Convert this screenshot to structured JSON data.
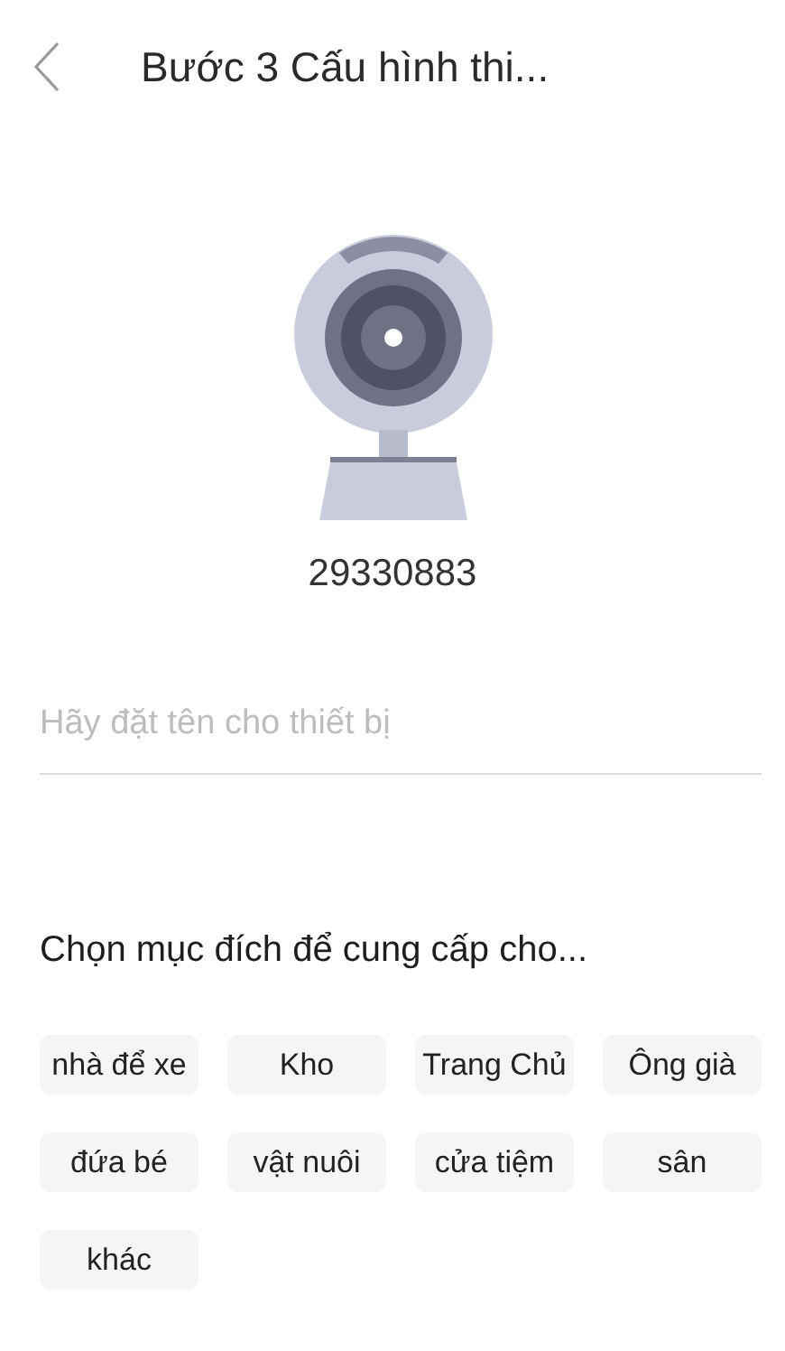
{
  "header": {
    "title": "Bước 3 Cấu hình thi..."
  },
  "device": {
    "id": "29330883"
  },
  "name_field": {
    "placeholder": "Hãy đặt tên cho thiết bị"
  },
  "purpose": {
    "heading": "Chọn mục đích để cung cấp cho...",
    "options": [
      {
        "label": "nhà để xe",
        "selected": false
      },
      {
        "label": "Kho",
        "selected": false
      },
      {
        "label": "Trang Chủ",
        "selected": false
      },
      {
        "label": "Ông già",
        "selected": false
      },
      {
        "label": "đứa bé",
        "selected": false
      },
      {
        "label": "vật nuôi",
        "selected": false
      },
      {
        "label": "cửa tiệm",
        "selected": false
      },
      {
        "label": "sân",
        "selected": false
      },
      {
        "label": "khác",
        "selected": false
      }
    ]
  }
}
